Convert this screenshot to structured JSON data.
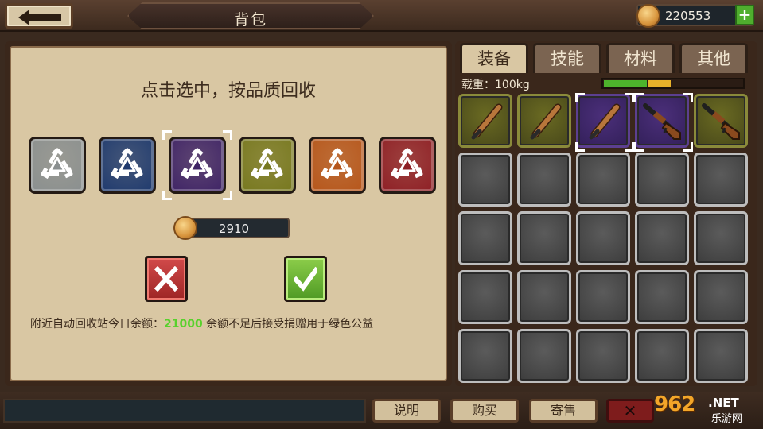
{
  "header": {
    "title": "背包",
    "coins": "220553",
    "back_icon": "arrow-left-icon",
    "add_icon": "plus-icon"
  },
  "recycle": {
    "instruction": "点击选中，按品质回收",
    "qualities": [
      {
        "name": "gray",
        "color": "#8a8f8f"
      },
      {
        "name": "blue",
        "color": "#1f3a6e"
      },
      {
        "name": "purple",
        "color": "#3f2466",
        "selected": true
      },
      {
        "name": "olive",
        "color": "#77781f"
      },
      {
        "name": "orange",
        "color": "#b6561b"
      },
      {
        "name": "red",
        "color": "#8e1f25"
      }
    ],
    "price": "2910",
    "note_prefix": "附近自动回收站今日余额：",
    "note_amount": "21000",
    "note_suffix": " 余额不足后接受捐赠用于绿色公益"
  },
  "inventory": {
    "tabs": [
      "装备",
      "技能",
      "材料",
      "其他"
    ],
    "active_tab": 0,
    "weight_label": "载重：100kg",
    "weight_fill": [
      {
        "color": "#4db32c",
        "fraction": 0.32
      },
      {
        "color": "#e8b22a",
        "fraction": 0.17
      }
    ],
    "items": [
      {
        "icon": "baseball-bat-icon",
        "rarity": "olive"
      },
      {
        "icon": "baseball-bat-icon",
        "rarity": "olive"
      },
      {
        "icon": "baseball-bat-icon",
        "rarity": "purple",
        "selected": true
      },
      {
        "icon": "shotgun-icon",
        "rarity": "purple",
        "selected": true
      },
      {
        "icon": "shotgun-icon",
        "rarity": "olive"
      }
    ],
    "empty_slots": 20
  },
  "footer": {
    "buttons": [
      "说明",
      "购买",
      "寄售"
    ],
    "close_label": "✕",
    "watermark_logo": "962",
    "watermark_net": ".NET",
    "watermark_cn": "乐游网"
  }
}
